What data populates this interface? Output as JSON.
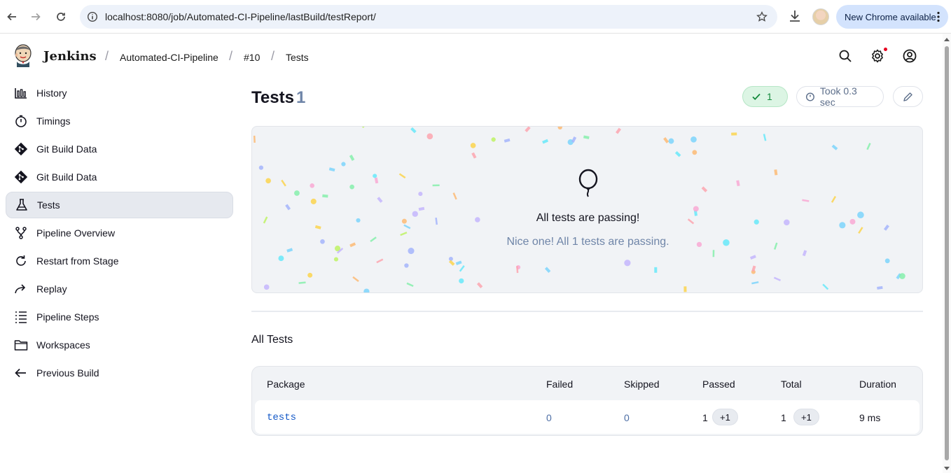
{
  "browser": {
    "url": "localhost:8080/job/Automated-CI-Pipeline/lastBuild/testReport/",
    "update_label": "New Chrome available"
  },
  "header": {
    "brand": "Jenkins",
    "breadcrumbs": [
      "Automated-CI-Pipeline",
      "#10",
      "Tests"
    ]
  },
  "sidebar": {
    "items": [
      {
        "label": "History",
        "icon": "history-icon"
      },
      {
        "label": "Timings",
        "icon": "timer-icon"
      },
      {
        "label": "Git Build Data",
        "icon": "git-icon"
      },
      {
        "label": "Git Build Data",
        "icon": "git-icon"
      },
      {
        "label": "Tests",
        "icon": "flask-icon",
        "active": true
      },
      {
        "label": "Pipeline Overview",
        "icon": "pipeline-icon"
      },
      {
        "label": "Restart from Stage",
        "icon": "restart-icon"
      },
      {
        "label": "Replay",
        "icon": "replay-icon"
      },
      {
        "label": "Pipeline Steps",
        "icon": "steps-icon"
      },
      {
        "label": "Workspaces",
        "icon": "folder-icon"
      },
      {
        "label": "Previous Build",
        "icon": "arrow-left-icon"
      }
    ]
  },
  "main": {
    "title": "Tests",
    "count": "1",
    "passed_badge": "1",
    "duration_badge": "Took 0.3 sec",
    "banner_title": "All tests are passing!",
    "banner_subtitle": "Nice one! All 1 tests are passing.",
    "section_title": "All Tests",
    "table": {
      "columns": [
        "Package",
        "Failed",
        "Skipped",
        "Passed",
        "Total",
        "Duration"
      ],
      "rows": [
        {
          "package": "tests",
          "failed": "0",
          "skipped": "0",
          "passed": "1",
          "passed_diff": "+1",
          "total": "1",
          "total_diff": "+1",
          "duration": "9 ms"
        }
      ]
    }
  },
  "colors": {
    "accent_link": "#1358c7",
    "pass_green": "#138a3c",
    "muted_blue": "#6f85a8"
  }
}
